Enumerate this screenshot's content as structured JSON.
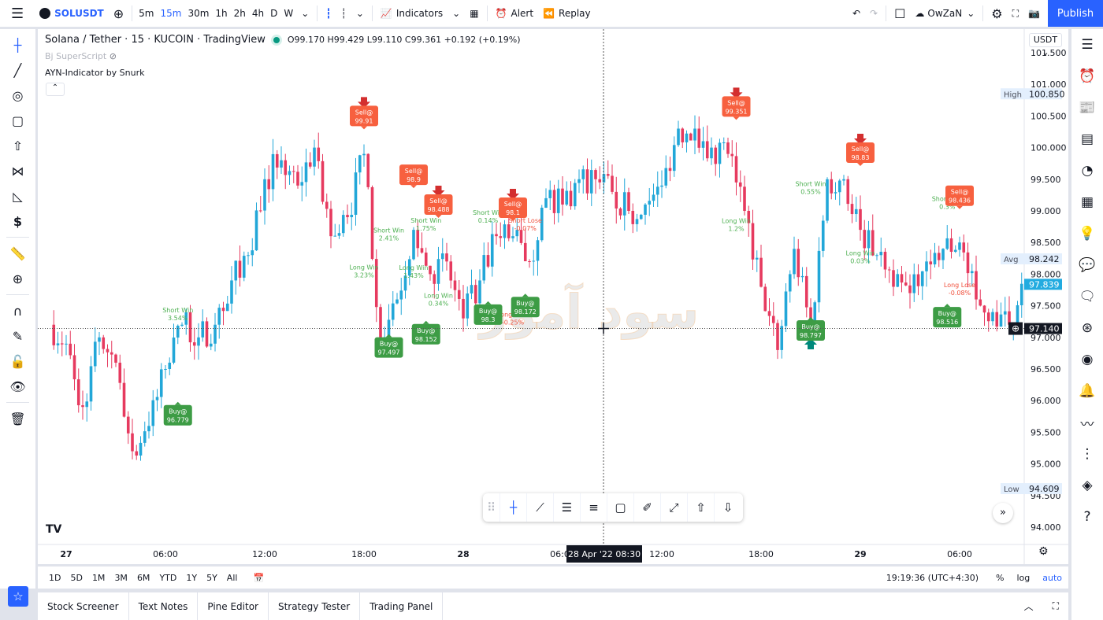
{
  "topbar": {
    "symbol": "SOLUSDT",
    "intervals": [
      "5m",
      "15m",
      "30m",
      "1h",
      "2h",
      "4h",
      "D",
      "W"
    ],
    "active_interval": "15m",
    "indicators_label": "Indicators",
    "alert_label": "Alert",
    "replay_label": "Replay",
    "layout_name": "OwZaN",
    "publish_label": "Publish"
  },
  "legend": {
    "title": "Solana / Tether · 15 · KUCOIN · TradingView",
    "ohlc": "O99.170 H99.429 L99.110 C99.361 +0.192 (+0.19%)",
    "indicator1": "Bj SuperScript",
    "indicator2": "AYN-Indicator by Snurk"
  },
  "price_axis": {
    "currency": "USDT",
    "ticks": [
      "101.500",
      "101.000",
      "100.500",
      "100.000",
      "99.500",
      "99.000",
      "98.500",
      "98.000",
      "97.500",
      "97.000",
      "96.500",
      "96.000",
      "95.500",
      "95.000",
      "94.500",
      "94.000"
    ],
    "high_label": "High",
    "high": "100.850",
    "low_label": "Low",
    "low": "94.609",
    "avg_label": "Avg",
    "avg": "98.242",
    "last": "97.839",
    "crosshair": "97.140"
  },
  "time_axis": {
    "ticks": [
      "27",
      "06:00",
      "12:00",
      "18:00",
      "28",
      "06:00",
      "12:00",
      "18:00",
      "29",
      "06:00"
    ],
    "crosshair": "28 Apr '22   08:30"
  },
  "watermark": "سود آموز",
  "colors": {
    "up": "#22a7d8",
    "down": "#e63a5f",
    "sell": "#f7603f",
    "buy": "#3d9c45",
    "win": "#4caf50",
    "lose": "#f0513d",
    "accent": "#2962ff"
  },
  "chart_data": {
    "type": "candlestick",
    "interval": "15m",
    "ylim": [
      94.0,
      101.5
    ],
    "path": [
      [
        "26 23:00",
        97.2
      ],
      [
        "27 00:00",
        96.9
      ],
      [
        "27 01:00",
        95.9
      ],
      [
        "27 02:00",
        97.0
      ],
      [
        "27 03:00",
        96.6
      ],
      [
        "27 04:00",
        95.2
      ],
      [
        "27 05:00",
        95.6
      ],
      [
        "27 06:00",
        96.5
      ],
      [
        "27 07:00",
        97.2
      ],
      [
        "27 08:00",
        97.0
      ],
      [
        "27 09:00",
        97.2
      ],
      [
        "27 10:00",
        97.9
      ],
      [
        "27 11:00",
        98.3
      ],
      [
        "27 12:00",
        99.5
      ],
      [
        "27 13:00",
        99.8
      ],
      [
        "27 14:00",
        99.4
      ],
      [
        "27 15:00",
        100.0
      ],
      [
        "27 16:00",
        98.6
      ],
      [
        "27 17:00",
        98.9
      ],
      [
        "27 18:00",
        99.9
      ],
      [
        "27 19:00",
        97.0
      ],
      [
        "27 20:00",
        97.6
      ],
      [
        "27 21:00",
        98.7
      ],
      [
        "27 22:00",
        98.0
      ],
      [
        "27 23:00",
        98.2
      ],
      [
        "28 00:00",
        97.3
      ],
      [
        "28 01:00",
        97.9
      ],
      [
        "28 02:00",
        98.6
      ],
      [
        "28 03:00",
        98.6
      ],
      [
        "28 04:00",
        98.2
      ],
      [
        "28 05:00",
        99.2
      ],
      [
        "28 06:00",
        99.1
      ],
      [
        "28 07:00",
        99.5
      ],
      [
        "28 08:00",
        99.5
      ],
      [
        "28 09:00",
        99.3
      ],
      [
        "28 10:00",
        99.0
      ],
      [
        "28 11:00",
        99.1
      ],
      [
        "28 12:00",
        99.4
      ],
      [
        "28 13:00",
        100.3
      ],
      [
        "28 14:00",
        100.3
      ],
      [
        "28 15:00",
        100.0
      ],
      [
        "28 16:00",
        99.9
      ],
      [
        "28 17:00",
        99.0
      ],
      [
        "28 18:00",
        97.8
      ],
      [
        "28 19:00",
        96.8
      ],
      [
        "28 20:00",
        98.4
      ],
      [
        "28 21:00",
        97.1
      ],
      [
        "28 22:00",
        99.5
      ],
      [
        "28 23:00",
        99.5
      ],
      [
        "29 00:00",
        98.7
      ],
      [
        "29 01:00",
        98.3
      ],
      [
        "29 02:00",
        97.8
      ],
      [
        "29 03:00",
        97.7
      ],
      [
        "29 04:00",
        98.2
      ],
      [
        "29 05:00",
        98.4
      ],
      [
        "29 06:00",
        98.5
      ],
      [
        "29 07:00",
        97.6
      ],
      [
        "29 08:00",
        97.4
      ],
      [
        "29 09:00",
        97.2
      ],
      [
        "29 10:00",
        97.839
      ]
    ],
    "signals": [
      {
        "type": "sell",
        "label": "Sell@",
        "price_text": "99.91",
        "time": "27 18:00",
        "at": 100.5,
        "arrow": true
      },
      {
        "type": "sell",
        "label": "Sell@",
        "price_text": "98.9",
        "time": "27 21:00",
        "at": 99.57,
        "arrow": false
      },
      {
        "type": "sell",
        "label": "Sell@",
        "price_text": "98.488",
        "time": "27 22:30",
        "at": 99.1,
        "arrow": true
      },
      {
        "type": "sell",
        "label": "Sell@",
        "price_text": "98.1",
        "time": "28 03:00",
        "at": 99.05,
        "arrow": true
      },
      {
        "type": "sell",
        "label": "Sell@",
        "price_text": "99.351",
        "time": "28 16:30",
        "at": 100.65,
        "arrow": true
      },
      {
        "type": "sell",
        "label": "Sell@",
        "price_text": "98.83",
        "time": "29 00:00",
        "at": 99.92,
        "arrow": true
      },
      {
        "type": "sell",
        "label": "Sell@",
        "price_text": "98.436",
        "time": "29 06:00",
        "at": 99.24,
        "arrow": false
      },
      {
        "type": "buy",
        "label": "Buy@",
        "price_text": "96.779",
        "time": "27 06:45",
        "at": 95.77,
        "arrow": false
      },
      {
        "type": "buy",
        "label": "Buy@",
        "price_text": "97.497",
        "time": "27 19:30",
        "at": 96.84,
        "arrow": false
      },
      {
        "type": "buy",
        "label": "Buy@",
        "price_text": "98.152",
        "time": "27 21:45",
        "at": 97.05,
        "arrow": false
      },
      {
        "type": "buy",
        "label": "Buy@",
        "price_text": "98.3",
        "time": "28 01:30",
        "at": 97.36,
        "arrow": false
      },
      {
        "type": "buy",
        "label": "Buy@",
        "price_text": "98.172",
        "time": "28 03:45",
        "at": 97.48,
        "arrow": false
      },
      {
        "type": "buy",
        "label": "Buy@",
        "price_text": "98.797",
        "time": "28 21:00",
        "at": 97.11,
        "arrow": true
      },
      {
        "type": "buy",
        "label": "Buy@",
        "price_text": "98.516",
        "time": "29 05:15",
        "at": 97.32,
        "arrow": false
      }
    ],
    "results": [
      {
        "l1": "Short Win",
        "l2": "3.54%",
        "win": true,
        "time": "27 06:45",
        "at": 97.37
      },
      {
        "l1": "Short Win",
        "l2": "2.41%",
        "win": true,
        "time": "27 19:30",
        "at": 98.63
      },
      {
        "l1": "Short Win",
        "l2": "1.75%",
        "win": true,
        "time": "27 21:45",
        "at": 98.79
      },
      {
        "l1": "Long Win",
        "l2": "3.23%",
        "win": true,
        "time": "27 18:00",
        "at": 98.05
      },
      {
        "l1": "Long Win",
        "l2": "1.43%",
        "win": true,
        "time": "27 21:00",
        "at": 98.04
      },
      {
        "l1": "Long Win",
        "l2": "0.34%",
        "win": true,
        "time": "27 22:30",
        "at": 97.6
      },
      {
        "l1": "Short Win",
        "l2": "0.14%",
        "win": true,
        "time": "28 01:30",
        "at": 98.91
      },
      {
        "l1": "Short Lose",
        "l2": "-0.07%",
        "win": false,
        "time": "28 03:45",
        "at": 98.79
      },
      {
        "l1": "Long Lose",
        "l2": "-0.25%",
        "win": false,
        "time": "28 03:00",
        "at": 97.3
      },
      {
        "l1": "Long Win",
        "l2": "1.2%",
        "win": true,
        "time": "28 16:30",
        "at": 98.78
      },
      {
        "l1": "Short Win",
        "l2": "0.55%",
        "win": true,
        "time": "28 21:00",
        "at": 99.37
      },
      {
        "l1": "Long Win",
        "l2": "0.03%",
        "win": true,
        "time": "29 00:00",
        "at": 98.27
      },
      {
        "l1": "Short Win",
        "l2": "0.3%",
        "win": true,
        "time": "29 05:15",
        "at": 99.13
      },
      {
        "l1": "Long Lose",
        "l2": "-0.08%",
        "win": false,
        "time": "29 06:00",
        "at": 97.77
      }
    ]
  },
  "rangebar": {
    "ranges": [
      "1D",
      "5D",
      "1M",
      "3M",
      "6M",
      "YTD",
      "1Y",
      "5Y",
      "All"
    ],
    "clock": "19:19:36 (UTC+4:30)",
    "percent": "%",
    "log": "log",
    "auto": "auto"
  },
  "bottom_tabs": [
    "Stock Screener",
    "Text Notes",
    "Pine Editor",
    "Strategy Tester",
    "Trading Panel"
  ]
}
